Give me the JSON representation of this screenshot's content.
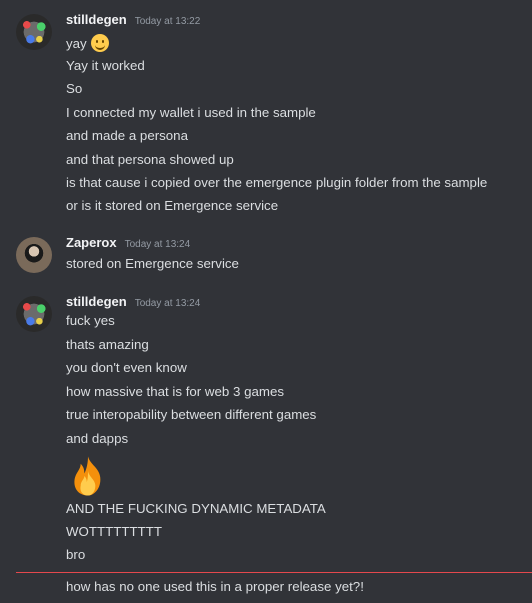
{
  "messages": [
    {
      "username": "stilldegen",
      "timestamp": "Today at 13:22",
      "avatar": "stilldegen-avatar",
      "lines": [
        "yay",
        "Yay it worked",
        "So",
        "I connected my wallet i used in the sample",
        "and made a persona",
        "and that persona showed up",
        "is that cause i copied over the emergence plugin folder from the sample",
        "or is it stored on Emergence service"
      ]
    },
    {
      "username": "Zaperox",
      "timestamp": "Today at 13:24",
      "avatar": "zaperox-avatar",
      "lines": [
        "stored on Emergence service"
      ]
    },
    {
      "username": "stilldegen",
      "timestamp": "Today at 13:24",
      "avatar": "stilldegen-avatar",
      "lines": [
        "fuck yes",
        "thats amazing",
        "you don't even know",
        "how massive that is for web 3 games",
        "true interopability between different games",
        "and dapps",
        "AND THE FUCKING DYNAMIC METADATA",
        "WOTTTTTTTTT",
        "bro",
        "how has no one used this in a proper release yet?!"
      ]
    }
  ],
  "emojis": {
    "smile": "slightly-smiling-face-icon",
    "fire": "fire-icon"
  },
  "colors": {
    "background": "#313338",
    "divider": "#e5484d"
  }
}
